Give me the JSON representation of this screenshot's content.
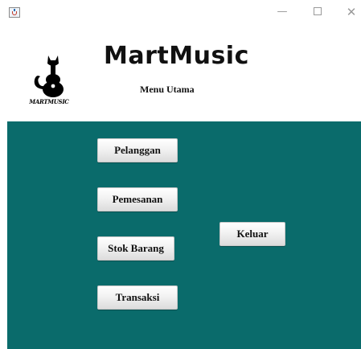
{
  "window": {
    "icons": {
      "app": "java-icon",
      "minimize": "minimize-icon",
      "maximize": "maximize-icon",
      "close": "close-icon"
    },
    "minimize_glyph": "—",
    "close_glyph": "✕"
  },
  "header": {
    "logo_text": "MARTMUSIC",
    "app_title": "MartMusic",
    "subtitle": "Menu Utama"
  },
  "menu": {
    "pelanggan": "Pelanggan",
    "pemesanan": "Pemesanan",
    "stok_barang": "Stok Barang",
    "transaksi": "Transaksi",
    "keluar": "Keluar"
  },
  "colors": {
    "panel_background": "#0a6b6b",
    "header_background": "#ffffff"
  }
}
